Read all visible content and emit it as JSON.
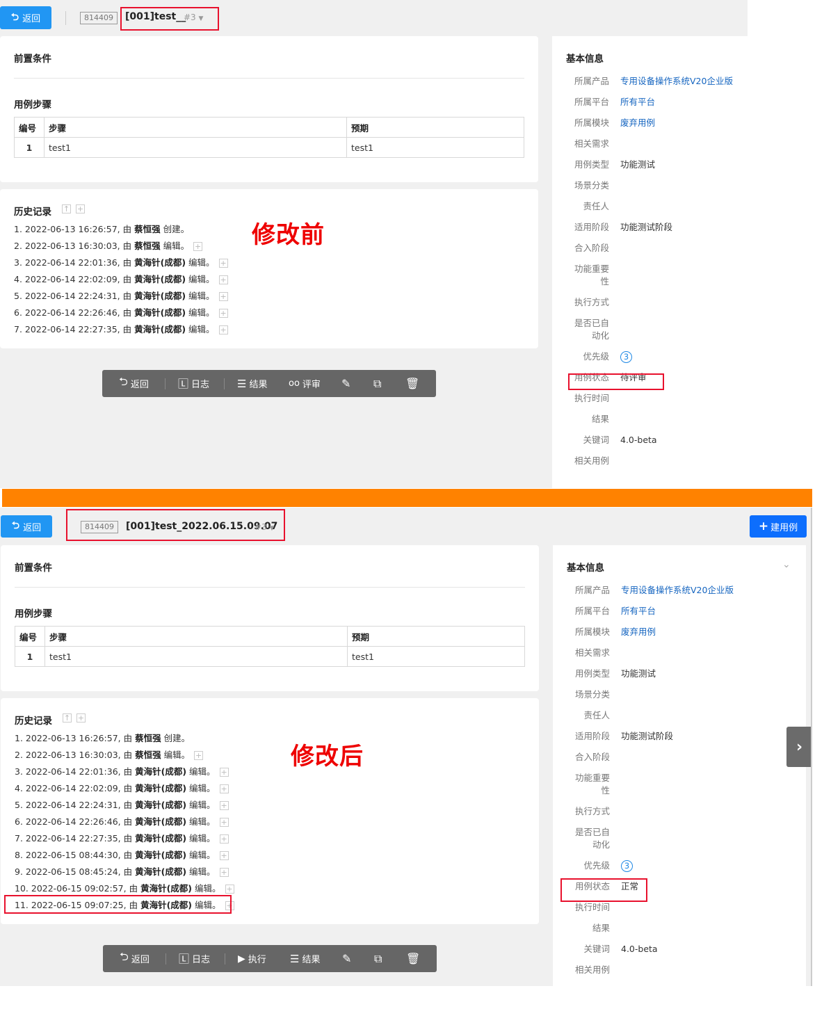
{
  "top": {
    "back_label": "返回",
    "case_id": "814409",
    "case_title": "[001]test__",
    "version": "#3",
    "precondition_title": "前置条件",
    "steps_title": "用例步骤",
    "steps_headers": [
      "编号",
      "步骤",
      "预期"
    ],
    "steps_rows": [
      {
        "num": "1",
        "step": "test1",
        "expect": "test1"
      }
    ],
    "history_title": "历史记录",
    "history": [
      {
        "idx": "1.",
        "time": "2022-06-13 16:26:57, 由",
        "user": "蔡恒强",
        "action": "创建。"
      },
      {
        "idx": "2.",
        "time": "2022-06-13 16:30:03, 由",
        "user": "蔡恒强",
        "action": "编辑。"
      },
      {
        "idx": "3.",
        "time": "2022-06-14 22:01:36, 由",
        "user": "黄海针(成都)",
        "action": "编辑。"
      },
      {
        "idx": "4.",
        "time": "2022-06-14 22:02:09, 由",
        "user": "黄海针(成都)",
        "action": "编辑。"
      },
      {
        "idx": "5.",
        "time": "2022-06-14 22:24:31, 由",
        "user": "黄海针(成都)",
        "action": "编辑。"
      },
      {
        "idx": "6.",
        "time": "2022-06-14 22:26:46, 由",
        "user": "黄海针(成都)",
        "action": "编辑。"
      },
      {
        "idx": "7.",
        "time": "2022-06-14 22:27:35, 由",
        "user": "黄海针(成都)",
        "action": "编辑。"
      }
    ],
    "overlay": "修改前",
    "toolbar": {
      "back": "返回",
      "log": "日志",
      "result": "结果",
      "review": "评审"
    },
    "info_title": "基本信息",
    "info": [
      {
        "label": "所属产品",
        "value": "专用设备操作系统V20企业版",
        "link": true
      },
      {
        "label": "所属平台",
        "value": "所有平台",
        "link": true
      },
      {
        "label": "所属模块",
        "value": "废弃用例",
        "link": true
      },
      {
        "label": "相关需求",
        "value": ""
      },
      {
        "label": "用例类型",
        "value": "功能测试"
      },
      {
        "label": "场景分类",
        "value": ""
      },
      {
        "label": "责任人",
        "value": ""
      },
      {
        "label": "适用阶段",
        "value": "功能测试阶段"
      },
      {
        "label": "合入阶段",
        "value": ""
      },
      {
        "label": "功能重要性",
        "value": ""
      },
      {
        "label": "执行方式",
        "value": ""
      },
      {
        "label": "是否已自动化",
        "value": ""
      },
      {
        "label": "优先级",
        "value": "3",
        "prio": true
      },
      {
        "label": "用例状态",
        "value": "待评审"
      },
      {
        "label": "执行时间",
        "value": ""
      },
      {
        "label": "结果",
        "value": ""
      },
      {
        "label": "关键词",
        "value": "4.0-beta"
      },
      {
        "label": "相关用例",
        "value": ""
      }
    ]
  },
  "bottom": {
    "back_label": "返回",
    "case_id": "814409",
    "case_title": "[001]test_2022.06.15.09.07",
    "version": "#3",
    "create_label": "建用例",
    "precondition_title": "前置条件",
    "steps_title": "用例步骤",
    "steps_headers": [
      "编号",
      "步骤",
      "预期"
    ],
    "steps_rows": [
      {
        "num": "1",
        "step": "test1",
        "expect": "test1"
      }
    ],
    "history_title": "历史记录",
    "history": [
      {
        "idx": "1.",
        "time": "2022-06-13 16:26:57, 由",
        "user": "蔡恒强",
        "action": "创建。"
      },
      {
        "idx": "2.",
        "time": "2022-06-13 16:30:03, 由",
        "user": "蔡恒强",
        "action": "编辑。"
      },
      {
        "idx": "3.",
        "time": "2022-06-14 22:01:36, 由",
        "user": "黄海针(成都)",
        "action": "编辑。"
      },
      {
        "idx": "4.",
        "time": "2022-06-14 22:02:09, 由",
        "user": "黄海针(成都)",
        "action": "编辑。"
      },
      {
        "idx": "5.",
        "time": "2022-06-14 22:24:31, 由",
        "user": "黄海针(成都)",
        "action": "编辑。"
      },
      {
        "idx": "6.",
        "time": "2022-06-14 22:26:46, 由",
        "user": "黄海针(成都)",
        "action": "编辑。"
      },
      {
        "idx": "7.",
        "time": "2022-06-14 22:27:35, 由",
        "user": "黄海针(成都)",
        "action": "编辑。"
      },
      {
        "idx": "8.",
        "time": "2022-06-15 08:44:30, 由",
        "user": "黄海针(成都)",
        "action": "编辑。"
      },
      {
        "idx": "9.",
        "time": "2022-06-15 08:45:24, 由",
        "user": "黄海针(成都)",
        "action": "编辑。"
      },
      {
        "idx": "10.",
        "time": "2022-06-15 09:02:57, 由",
        "user": "黄海针(成都)",
        "action": "编辑。"
      },
      {
        "idx": "11.",
        "time": "2022-06-15 09:07:25, 由",
        "user": "黄海针(成都)",
        "action": "编辑。"
      }
    ],
    "overlay": "修改后",
    "toolbar": {
      "back": "返回",
      "log": "日志",
      "run": "执行",
      "result": "结果"
    },
    "info_title": "基本信息",
    "info": [
      {
        "label": "所属产品",
        "value": "专用设备操作系统V20企业版",
        "link": true
      },
      {
        "label": "所属平台",
        "value": "所有平台",
        "link": true
      },
      {
        "label": "所属模块",
        "value": "废弃用例",
        "link": true
      },
      {
        "label": "相关需求",
        "value": ""
      },
      {
        "label": "用例类型",
        "value": "功能测试"
      },
      {
        "label": "场景分类",
        "value": ""
      },
      {
        "label": "责任人",
        "value": ""
      },
      {
        "label": "适用阶段",
        "value": "功能测试阶段"
      },
      {
        "label": "合入阶段",
        "value": ""
      },
      {
        "label": "功能重要性",
        "value": ""
      },
      {
        "label": "执行方式",
        "value": ""
      },
      {
        "label": "是否已自动化",
        "value": ""
      },
      {
        "label": "优先级",
        "value": "3",
        "prio": true
      },
      {
        "label": "用例状态",
        "value": "正常"
      },
      {
        "label": "执行时间",
        "value": ""
      },
      {
        "label": "结果",
        "value": ""
      },
      {
        "label": "关键词",
        "value": "4.0-beta"
      },
      {
        "label": "相关用例",
        "value": ""
      }
    ]
  },
  "colors": {
    "primary": "#2196f3",
    "create": "#0d6efd",
    "divider": "#ff8200",
    "highlight": "#e8112d",
    "link": "#1565c0"
  }
}
